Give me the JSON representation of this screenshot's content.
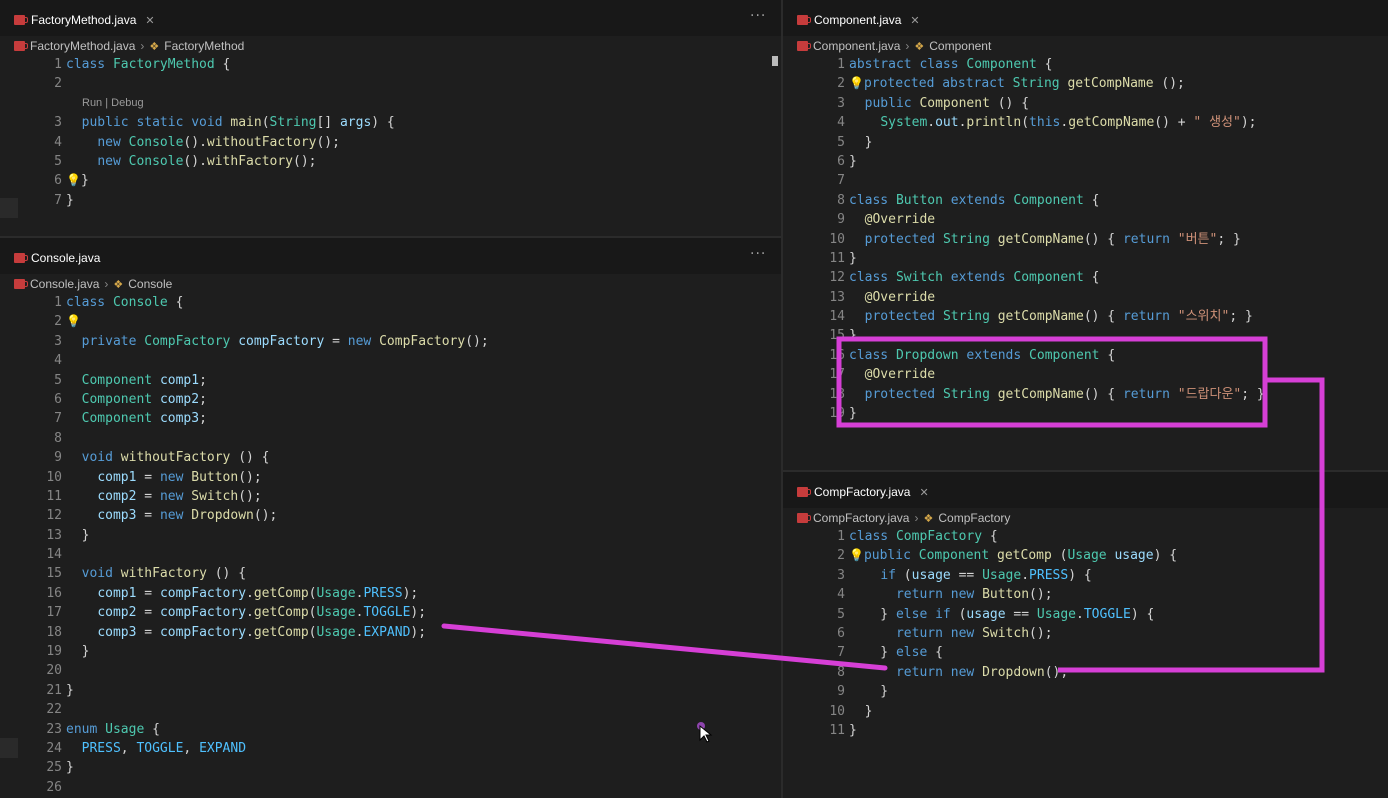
{
  "panes": {
    "factory_method": {
      "tab": "FactoryMethod.java",
      "crumb_file": "FactoryMethod.java",
      "crumb_symbol": "FactoryMethod",
      "codelens": "Run | Debug",
      "lines": [
        {
          "n": "1",
          "t": "class FactoryMethod {"
        },
        {
          "n": "2",
          "t": ""
        },
        {
          "n": "3",
          "t": "  public static void main(String[] args) {"
        },
        {
          "n": "4",
          "t": "    new Console().withoutFactory();"
        },
        {
          "n": "5",
          "t": "    new Console().withFactory();"
        },
        {
          "n": "6",
          "t": "  }"
        },
        {
          "n": "7",
          "t": "}"
        }
      ]
    },
    "console": {
      "tab": "Console.java",
      "crumb_file": "Console.java",
      "crumb_symbol": "Console",
      "lines": [
        {
          "n": "1",
          "t": "class Console {"
        },
        {
          "n": "2",
          "t": ""
        },
        {
          "n": "3",
          "t": "  private CompFactory compFactory = new CompFactory();"
        },
        {
          "n": "4",
          "t": ""
        },
        {
          "n": "5",
          "t": "  Component comp1;"
        },
        {
          "n": "6",
          "t": "  Component comp2;"
        },
        {
          "n": "7",
          "t": "  Component comp3;"
        },
        {
          "n": "8",
          "t": ""
        },
        {
          "n": "9",
          "t": "  void withoutFactory () {"
        },
        {
          "n": "10",
          "t": "    comp1 = new Button();"
        },
        {
          "n": "11",
          "t": "    comp2 = new Switch();"
        },
        {
          "n": "12",
          "t": "    comp3 = new Dropdown();"
        },
        {
          "n": "13",
          "t": "  }"
        },
        {
          "n": "14",
          "t": ""
        },
        {
          "n": "15",
          "t": "  void withFactory () {"
        },
        {
          "n": "16",
          "t": "    comp1 = compFactory.getComp(Usage.PRESS);"
        },
        {
          "n": "17",
          "t": "    comp2 = compFactory.getComp(Usage.TOGGLE);"
        },
        {
          "n": "18",
          "t": "    comp3 = compFactory.getComp(Usage.EXPAND);"
        },
        {
          "n": "19",
          "t": "  }"
        },
        {
          "n": "20",
          "t": ""
        },
        {
          "n": "21",
          "t": "}"
        },
        {
          "n": "22",
          "t": ""
        },
        {
          "n": "23",
          "t": "enum Usage {"
        },
        {
          "n": "24",
          "t": "  PRESS, TOGGLE, EXPAND"
        },
        {
          "n": "25",
          "t": "}"
        },
        {
          "n": "26",
          "t": ""
        }
      ]
    },
    "component": {
      "tab": "Component.java",
      "crumb_file": "Component.java",
      "crumb_symbol": "Component",
      "lines": [
        {
          "n": "1",
          "t": "abstract class Component {"
        },
        {
          "n": "2",
          "t": "  protected abstract String getCompName ();"
        },
        {
          "n": "3",
          "t": "  public Component () {"
        },
        {
          "n": "4",
          "t": "    System.out.println(this.getCompName() + \" 생성\");"
        },
        {
          "n": "5",
          "t": "  }"
        },
        {
          "n": "6",
          "t": "}"
        },
        {
          "n": "7",
          "t": ""
        },
        {
          "n": "8",
          "t": "class Button extends Component {"
        },
        {
          "n": "9",
          "t": "  @Override"
        },
        {
          "n": "10",
          "t": "  protected String getCompName() { return \"버튼\"; }"
        },
        {
          "n": "11",
          "t": "}"
        },
        {
          "n": "12",
          "t": "class Switch extends Component {"
        },
        {
          "n": "13",
          "t": "  @Override"
        },
        {
          "n": "14",
          "t": "  protected String getCompName() { return \"스위치\"; }"
        },
        {
          "n": "15",
          "t": "}"
        },
        {
          "n": "16",
          "t": "class Dropdown extends Component {"
        },
        {
          "n": "17",
          "t": "  @Override"
        },
        {
          "n": "18",
          "t": "  protected String getCompName() { return \"드랍다운\"; }"
        },
        {
          "n": "19",
          "t": "}"
        }
      ]
    },
    "comp_factory": {
      "tab": "CompFactory.java",
      "crumb_file": "CompFactory.java",
      "crumb_symbol": "CompFactory",
      "lines": [
        {
          "n": "1",
          "t": "class CompFactory {"
        },
        {
          "n": "2",
          "t": "  public Component getComp (Usage usage) {"
        },
        {
          "n": "3",
          "t": "    if (usage == Usage.PRESS) {"
        },
        {
          "n": "4",
          "t": "      return new Button();"
        },
        {
          "n": "5",
          "t": "    } else if (usage == Usage.TOGGLE) {"
        },
        {
          "n": "6",
          "t": "      return new Switch();"
        },
        {
          "n": "7",
          "t": "    } else {"
        },
        {
          "n": "8",
          "t": "      return new Dropdown();"
        },
        {
          "n": "9",
          "t": "    }"
        },
        {
          "n": "10",
          "t": "  }"
        },
        {
          "n": "11",
          "t": "}"
        }
      ]
    }
  },
  "annotation_color": "#d63fd6"
}
